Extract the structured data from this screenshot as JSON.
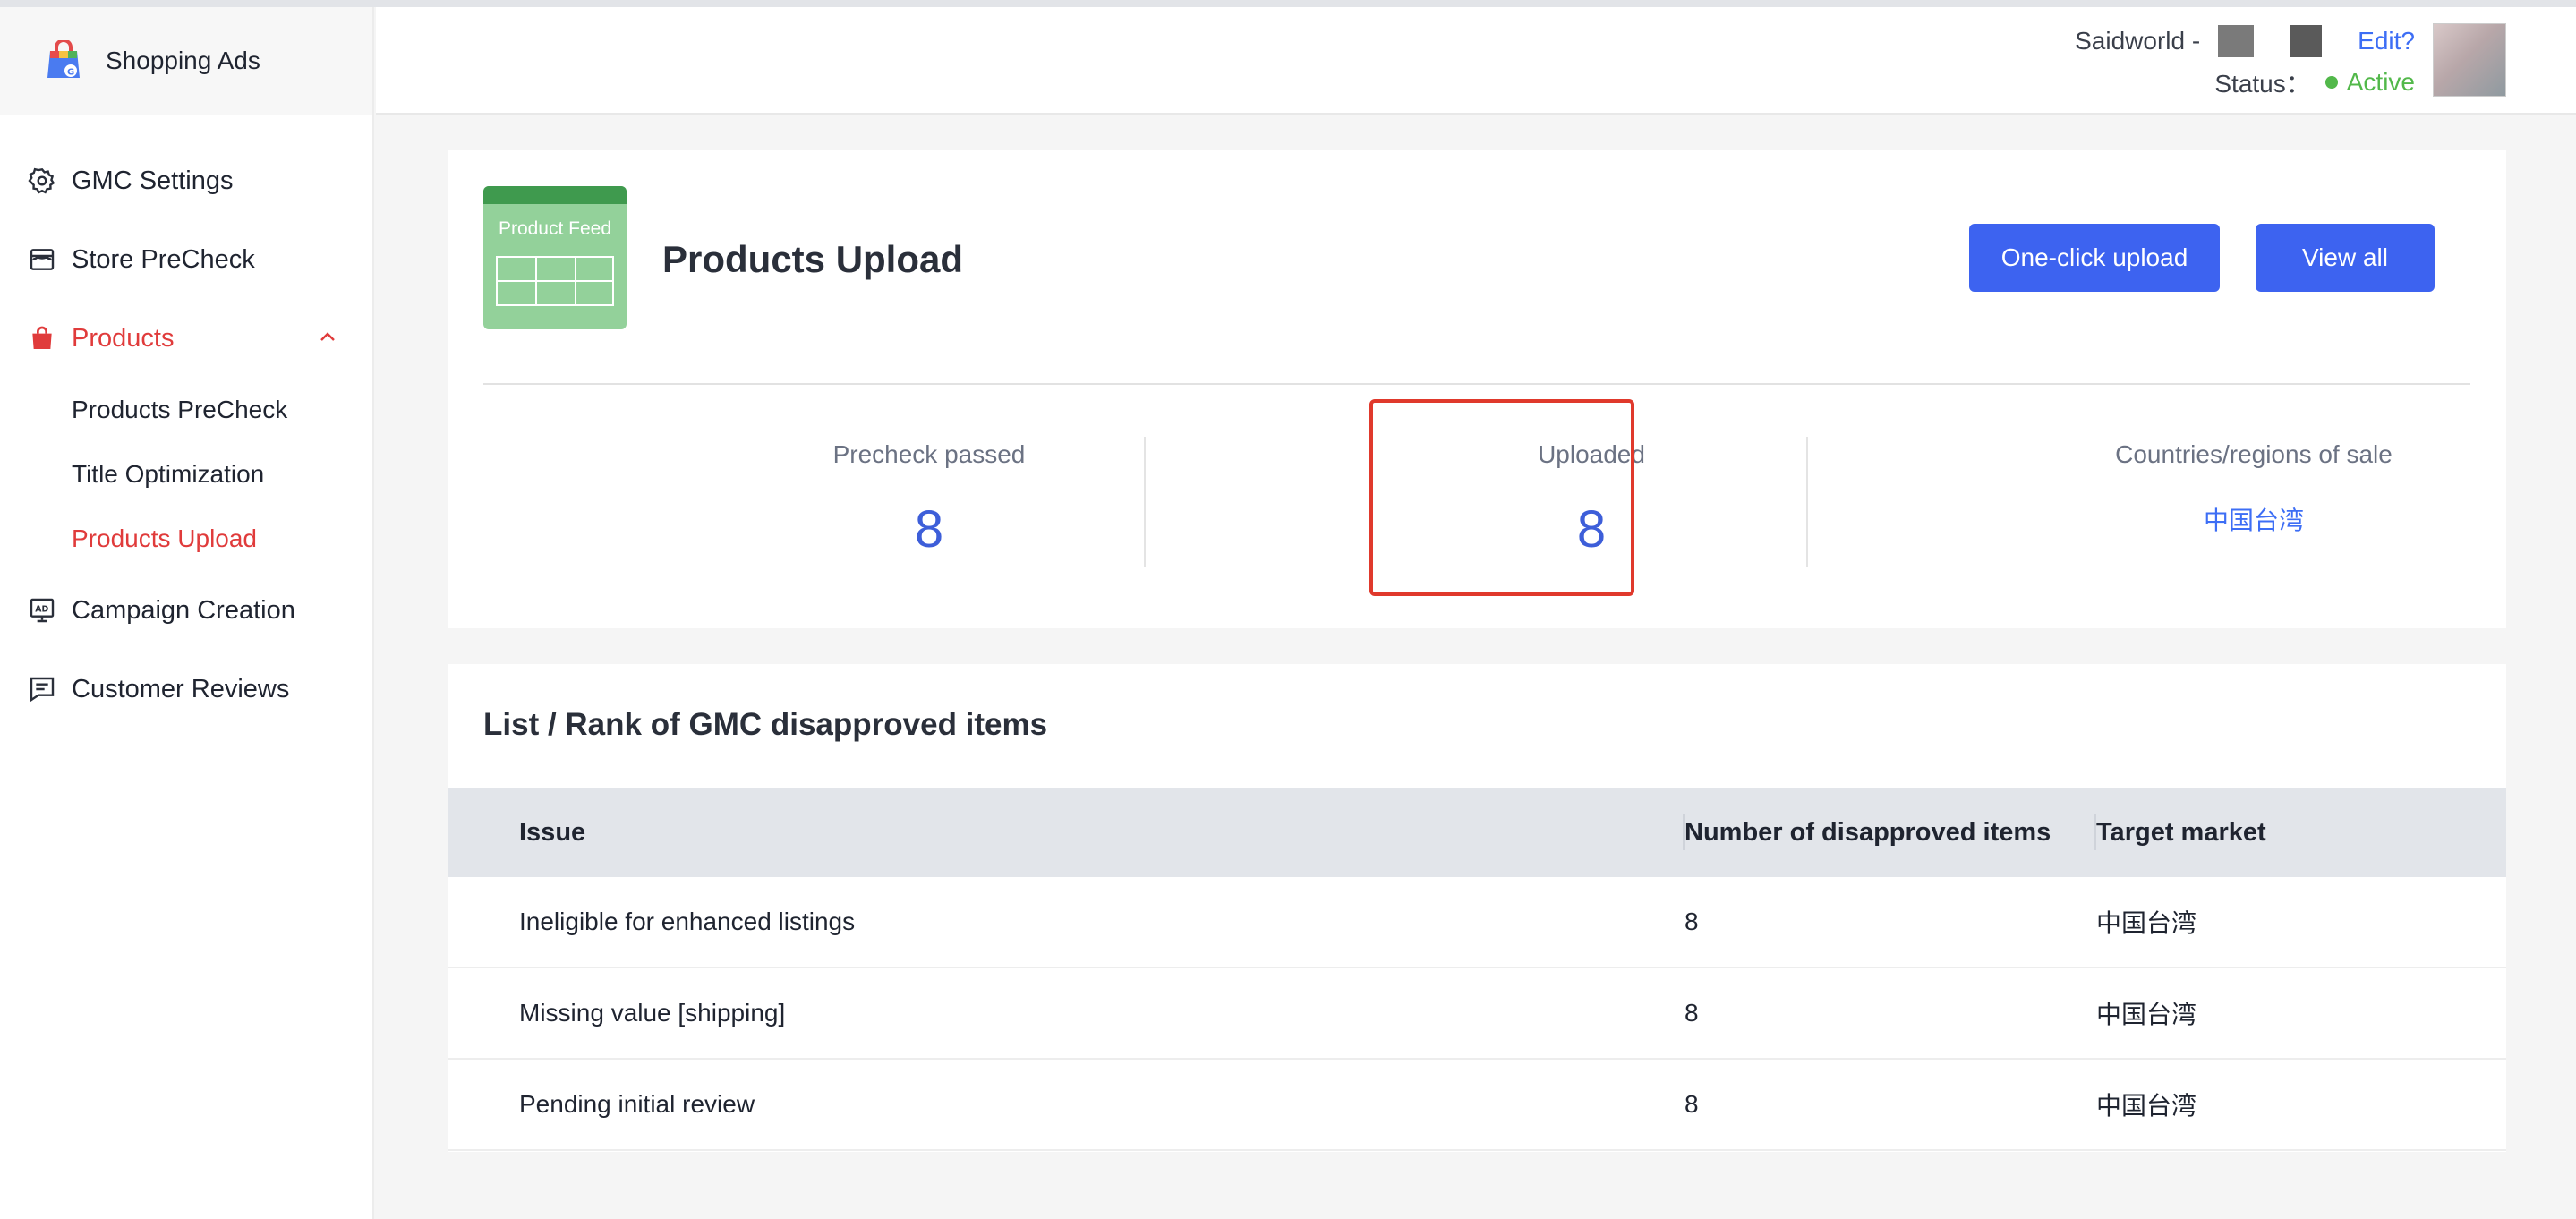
{
  "brand": {
    "name": "Shopping Ads",
    "logo_icon": "shopping-bag-g-icon"
  },
  "sidebar": {
    "items": [
      {
        "label": "GMC Settings",
        "icon": "gear-icon"
      },
      {
        "label": "Store PreCheck",
        "icon": "store-icon"
      },
      {
        "label": "Products",
        "icon": "bag-icon",
        "expanded": true,
        "active": true
      },
      {
        "label": "Campaign Creation",
        "icon": "ad-icon"
      },
      {
        "label": "Customer Reviews",
        "icon": "review-icon"
      }
    ],
    "products_sub": [
      {
        "label": "Products PreCheck"
      },
      {
        "label": "Title Optimization"
      },
      {
        "label": "Products Upload",
        "active": true
      }
    ]
  },
  "header": {
    "account_prefix": "Saidworld -",
    "edit_label": "Edit?",
    "status_label": "Status：",
    "status_value": "Active"
  },
  "upload_card": {
    "feed_icon_label": "Product Feed",
    "title": "Products Upload",
    "btn_upload": "One-click upload",
    "btn_viewall": "View all",
    "stats": {
      "precheck_label": "Precheck passed",
      "precheck_value": "8",
      "uploaded_label": "Uploaded",
      "uploaded_value": "8",
      "countries_label": "Countries/regions of sale",
      "countries_value": "中国台湾"
    }
  },
  "disapproved": {
    "title": "List / Rank of GMC disapproved items",
    "columns": [
      "Issue",
      "Number of disapproved items",
      "Target market"
    ],
    "rows": [
      {
        "issue": "Ineligible for enhanced listings",
        "count": "8",
        "market": "中国台湾"
      },
      {
        "issue": "Missing value [shipping]",
        "count": "8",
        "market": "中国台湾"
      },
      {
        "issue": "Pending initial review",
        "count": "8",
        "market": "中国台湾"
      }
    ]
  },
  "colors": {
    "accent": "#3d63f0",
    "active_nav": "#e03b3b",
    "status_green": "#52b84a",
    "highlight_border": "#e0392c"
  }
}
